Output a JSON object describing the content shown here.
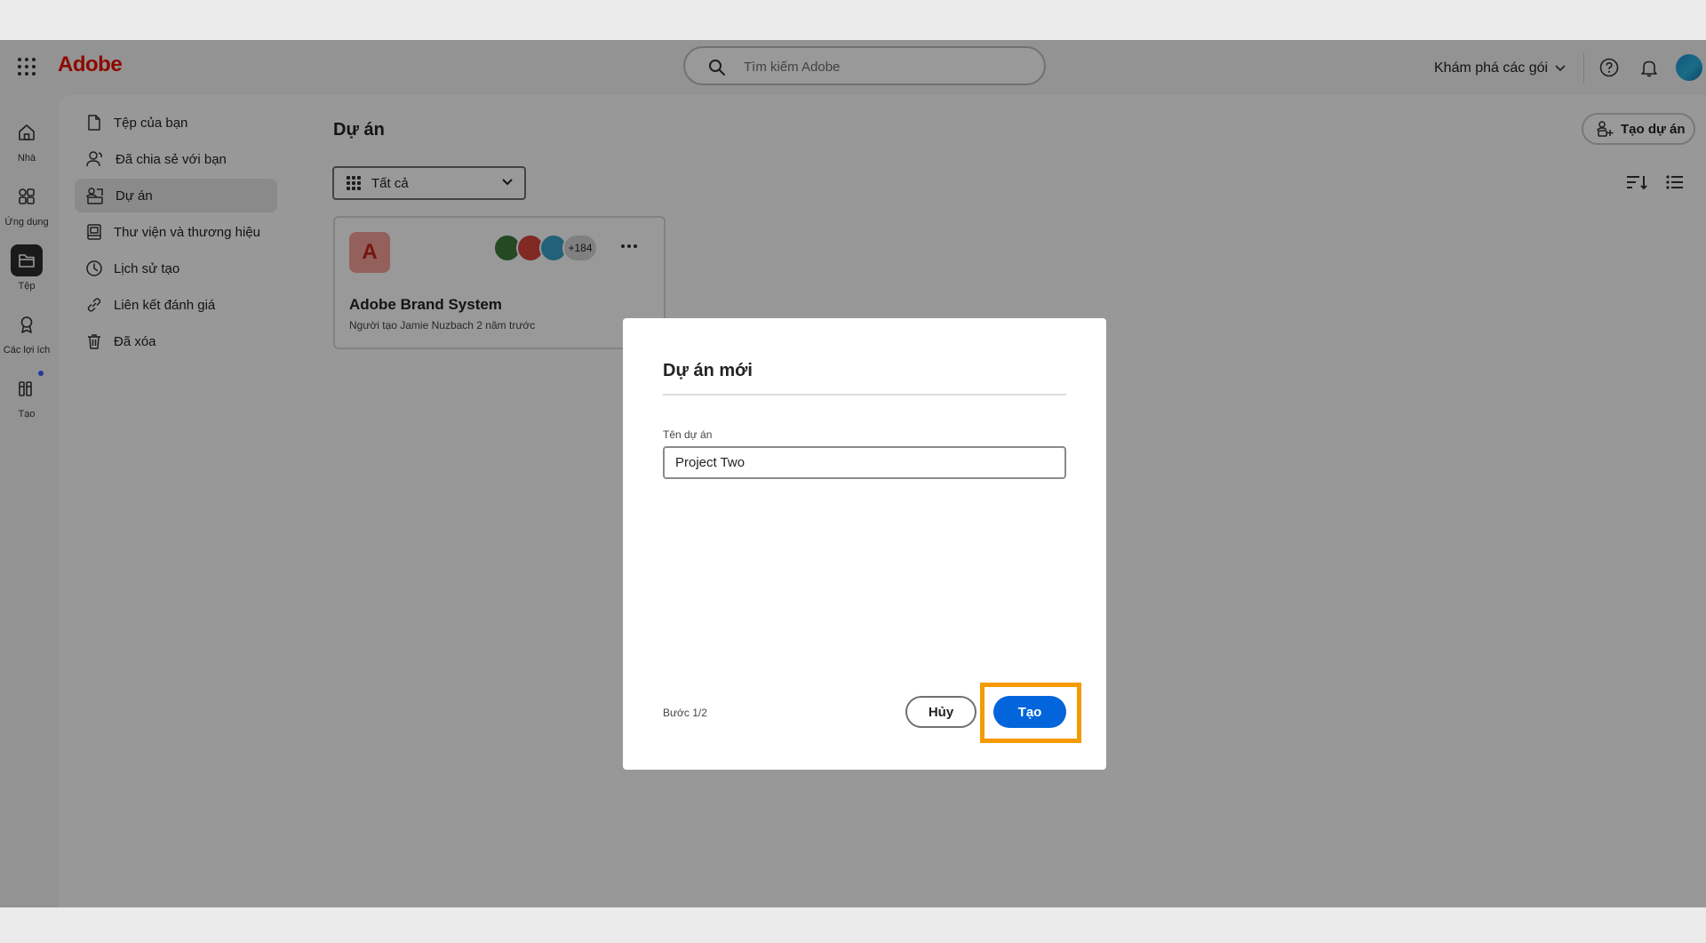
{
  "topbar": {
    "brand": "Adobe",
    "search_placeholder": "Tìm kiếm Adobe",
    "plans_label": "Khám phá các gói"
  },
  "rail": {
    "items": [
      {
        "label": "Nhà",
        "icon": "home-icon"
      },
      {
        "label": "Ứng dụng",
        "icon": "apps-icon"
      },
      {
        "label": "Tệp",
        "icon": "folder-icon",
        "active": true
      },
      {
        "label": "Các lợi ích",
        "icon": "award-icon"
      },
      {
        "label": "Tạo",
        "icon": "create-icon"
      }
    ]
  },
  "sidebar": {
    "items": [
      {
        "label": "Tệp của bạn",
        "icon": "file-icon"
      },
      {
        "label": "Đã chia sẻ với bạn",
        "icon": "shared-user-icon"
      },
      {
        "label": "Dự án",
        "icon": "project-icon",
        "active": true
      },
      {
        "label": "Thư viện và thương hiệu",
        "icon": "library-icon"
      },
      {
        "label": "Lịch sử tạo",
        "icon": "history-icon"
      },
      {
        "label": "Liên kết đánh giá",
        "icon": "link-icon"
      },
      {
        "label": "Đã xóa",
        "icon": "trash-icon"
      }
    ]
  },
  "main": {
    "title": "Dự án",
    "filter_label": "Tất cả",
    "create_project_label": "Tạo dự án",
    "card": {
      "logo_letter": "A",
      "member_count": "+184",
      "name": "Adobe Brand System",
      "meta": "Người tạo Jamie Nuzbach 2 năm trước"
    }
  },
  "modal": {
    "title": "Dự án mới",
    "field_label": "Tên dự án",
    "field_value": "Project Two",
    "step": "Bước 1/2",
    "cancel_label": "Hủy",
    "create_label": "Tạo"
  },
  "colors": {
    "brand": "#eb1000",
    "primary_button": "#0265dc",
    "highlight": "#f59a00"
  }
}
